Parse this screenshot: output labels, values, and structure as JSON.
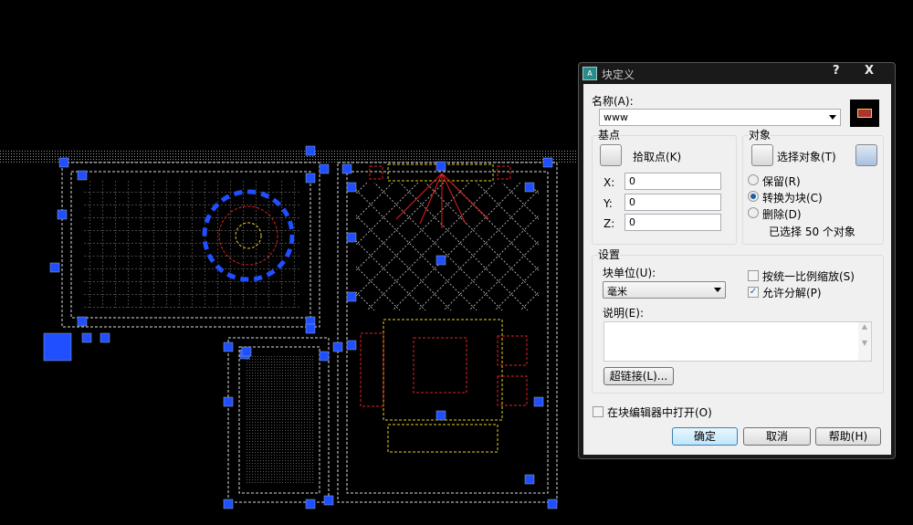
{
  "dialog": {
    "title": "块定义",
    "help_label": "?",
    "close_label": "X",
    "name_label": "名称(A):",
    "name_value": "www",
    "base_point": {
      "group_label": "基点",
      "pick_label": "拾取点(K)",
      "x_label": "X:",
      "x_value": "0",
      "y_label": "Y:",
      "y_value": "0",
      "z_label": "Z:",
      "z_value": "0"
    },
    "objects": {
      "group_label": "对象",
      "select_label": "选择对象(T)",
      "retain_label": "保留(R)",
      "convert_label": "转换为块(C)",
      "delete_label": "删除(D)",
      "selected_mode": "convert",
      "count_text": "已选择 50 个对象"
    },
    "settings": {
      "group_label": "设置",
      "unit_label": "块单位(U):",
      "unit_value": "毫米",
      "uniform_scale_label": "按统一比例缩放(S)",
      "uniform_scale_checked": false,
      "allow_explode_label": "允许分解(P)",
      "allow_explode_checked": true,
      "description_label": "说明(E):",
      "description_value": "",
      "hyperlink_label": "超链接(L)..."
    },
    "open_in_editor_label": "在块编辑器中打开(O)",
    "open_in_editor_checked": false,
    "ok_label": "确定",
    "cancel_label": "取消",
    "help_button_label": "帮助(H)"
  },
  "colors": {
    "grip": "#1f4fff",
    "lines": "#d8d8d8",
    "accent_red": "#e02020",
    "accent_yellow": "#e8d020"
  }
}
